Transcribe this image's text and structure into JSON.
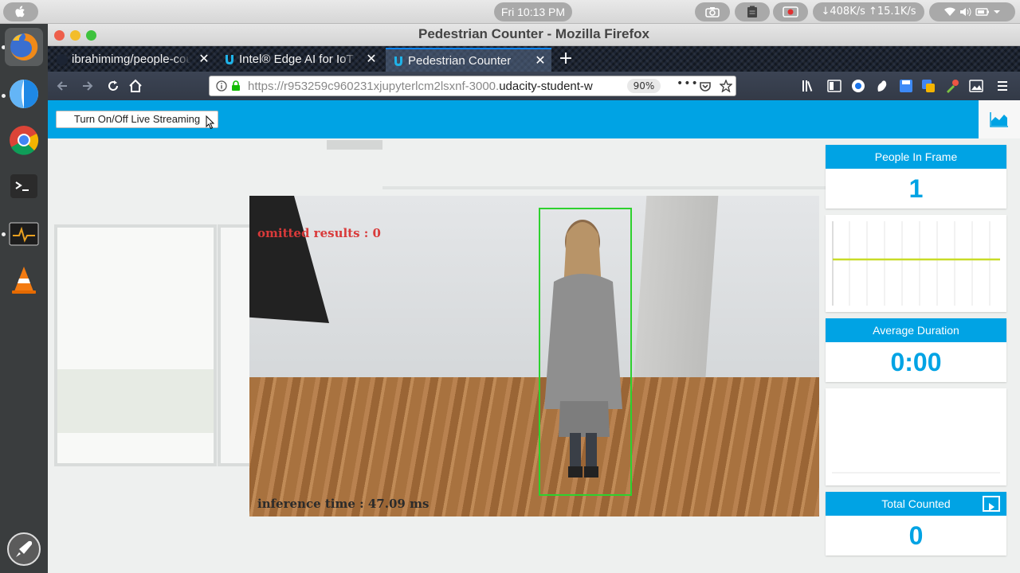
{
  "system_bar": {
    "clock": "Fri 10:13 PM",
    "network": "↓408K/s ↑15.1K/s"
  },
  "window": {
    "title": "Pedestrian Counter - Mozilla Firefox"
  },
  "tabs": [
    {
      "label": "ibrahimimg/people-counter",
      "icon": "github-icon"
    },
    {
      "label": "Intel® Edge AI for IoT Developers",
      "icon": "udacity-icon"
    },
    {
      "label": "Pedestrian Counter",
      "icon": "udacity-icon",
      "selected": true
    }
  ],
  "navbar": {
    "url_prefix": "https://r953259c960231xjupyterlcm2lsxnf-3000.",
    "url_domain": "udacity-student-w",
    "zoom": "90%"
  },
  "app": {
    "stream_button": "Turn On/Off Live Streaming",
    "video": {
      "omitted": "omitted results : 0",
      "inference": "inference time : 47.09 ms"
    },
    "cards": {
      "people_title": "People In Frame",
      "people_value": "1",
      "avg_title": "Average Duration",
      "avg_value": "0:00",
      "total_title": "Total Counted",
      "total_value": "0"
    }
  },
  "colors": {
    "accent": "#00a3e4",
    "detection": "#2ed12e",
    "graph_line": "#c8dc28"
  }
}
